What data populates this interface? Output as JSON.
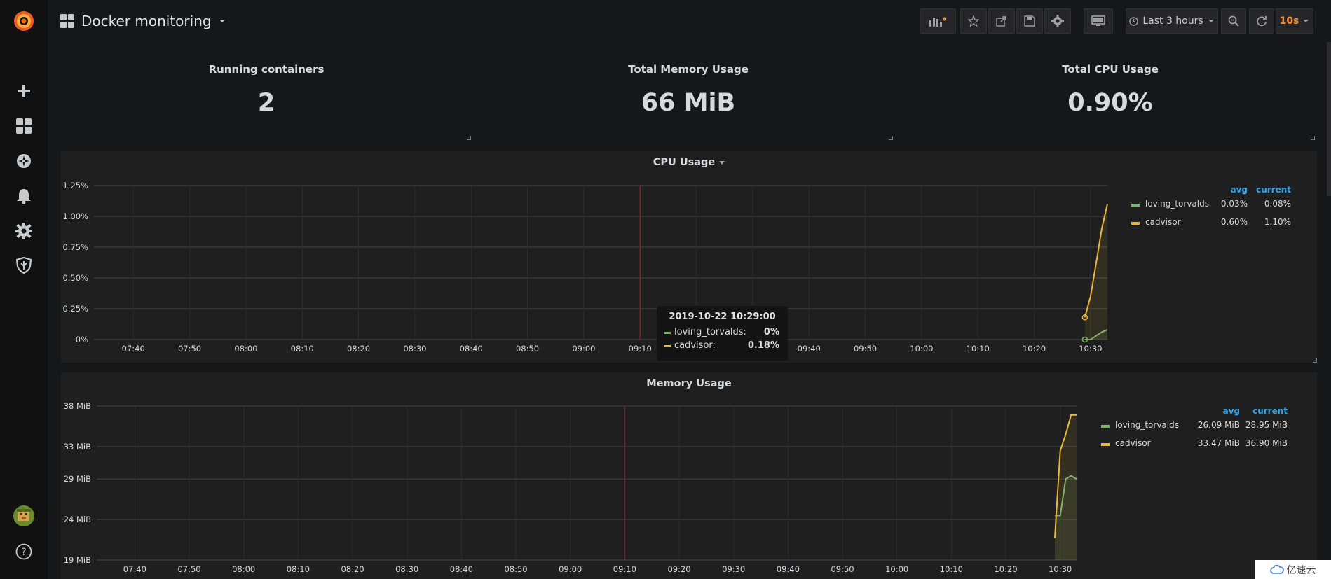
{
  "navbar": {
    "title": "Docker monitoring",
    "time_range": "Last 3 hours",
    "refresh_interval": "10s"
  },
  "stats": [
    {
      "title": "Running containers",
      "value": "2"
    },
    {
      "title": "Total Memory Usage",
      "value": "66 MiB"
    },
    {
      "title": "Total CPU Usage",
      "value": "0.90%"
    }
  ],
  "cpu_panel": {
    "title": "CPU Usage",
    "legend_headers": {
      "avg": "avg",
      "current": "current"
    },
    "legend": [
      {
        "name": "loving_torvalds",
        "avg": "0.03%",
        "current": "0.08%",
        "color": "#7eb26d"
      },
      {
        "name": "cadvisor",
        "avg": "0.60%",
        "current": "1.10%",
        "color": "#eab839"
      }
    ],
    "tooltip": {
      "time": "2019-10-22 10:29:00",
      "rows": [
        {
          "name": "loving_torvalds:",
          "value": "0%",
          "color": "#7eb26d"
        },
        {
          "name": "cadvisor:",
          "value": "0.18%",
          "color": "#eab839"
        }
      ]
    }
  },
  "memory_panel": {
    "title": "Memory Usage",
    "legend_headers": {
      "avg": "avg",
      "current": "current"
    },
    "legend": [
      {
        "name": "loving_torvalds",
        "avg": "26.09 MiB",
        "current": "28.95 MiB",
        "color": "#7eb26d"
      },
      {
        "name": "cadvisor",
        "avg": "33.47 MiB",
        "current": "36.90 MiB",
        "color": "#eab839"
      }
    ]
  },
  "watermark": "亿速云",
  "chart_data": [
    {
      "type": "line",
      "title": "CPU Usage",
      "x_ticks": [
        "07:40",
        "07:50",
        "08:00",
        "08:10",
        "08:20",
        "08:30",
        "08:40",
        "08:50",
        "09:00",
        "09:10",
        "09:20",
        "09:30",
        "09:40",
        "09:50",
        "10:00",
        "10:10",
        "10:20",
        "10:30"
      ],
      "y_ticks": [
        "0%",
        "0.25%",
        "0.50%",
        "0.75%",
        "1.00%",
        "1.25%"
      ],
      "ylim": [
        0,
        1.25
      ],
      "x_range_minutes": [
        "07:33",
        "10:33"
      ],
      "marker_time": "09:10",
      "series": [
        {
          "name": "loving_torvalds",
          "color": "#7eb26d",
          "x": [
            "10:29",
            "10:30",
            "10:31",
            "10:32",
            "10:33"
          ],
          "y": [
            0,
            0,
            0.03,
            0.06,
            0.08
          ]
        },
        {
          "name": "cadvisor",
          "color": "#eab839",
          "x": [
            "10:29",
            "10:30",
            "10:31",
            "10:32",
            "10:33"
          ],
          "y": [
            0.18,
            0.35,
            0.62,
            0.9,
            1.1
          ]
        }
      ]
    },
    {
      "type": "line",
      "title": "Memory Usage",
      "x_ticks": [
        "07:40",
        "07:50",
        "08:00",
        "08:10",
        "08:20",
        "08:30",
        "08:40",
        "08:50",
        "09:00",
        "09:10",
        "09:20",
        "09:30",
        "09:40",
        "09:50",
        "10:00",
        "10:10",
        "10:20",
        "10:30"
      ],
      "y_ticks": [
        "19 MiB",
        "24 MiB",
        "29 MiB",
        "33 MiB",
        "38 MiB"
      ],
      "ylim": [
        19,
        38
      ],
      "x_range_minutes": [
        "07:33",
        "10:33"
      ],
      "marker_time": "09:10",
      "series": [
        {
          "name": "loving_torvalds",
          "color": "#7eb26d",
          "x": [
            "10:29",
            "10:30",
            "10:31",
            "10:32",
            "10:33"
          ],
          "y": [
            24.5,
            24.5,
            29.0,
            29.4,
            29.0
          ]
        },
        {
          "name": "cadvisor",
          "color": "#eab839",
          "x": [
            "10:29",
            "10:30",
            "10:31",
            "10:32",
            "10:33"
          ],
          "y": [
            21.7,
            32.5,
            34.5,
            36.9,
            36.9
          ]
        }
      ]
    }
  ]
}
